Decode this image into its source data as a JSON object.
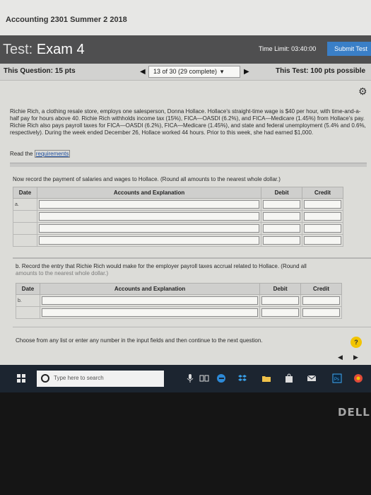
{
  "window": {
    "course_title": "Accounting 2301 Summer 2 2018"
  },
  "header": {
    "test_label": "Test:",
    "test_name": "Exam 4",
    "time_limit": "Time Limit: 03:40:00",
    "submit_label": "Submit Test"
  },
  "question_bar": {
    "question_points": "This Question: 15 pts",
    "progress": "13 of 30 (29 complete)",
    "test_points": "This Test: 100 pts possible"
  },
  "problem": {
    "text": "Richie Rich, a clothing resale store, employs one salesperson, Donna Hollace. Hollace's straight-time wage is $40 per hour, with time-and-a-half pay for hours above 40. Richie Rich withholds income tax (15%), FICA—OASDI (6.2%), and FICA—Medicare (1.45%) from Hollace's pay. Richie Rich also pays payroll taxes for FICA—OASDI (6.2%), FICA—Medicare (1.45%), and state and federal unemployment (5.4% and 0.6%, respectively). During the week ended December 26, Hollace worked 44 hours. Prior to this week, she had earned $1,000.",
    "read_prefix": "Read the",
    "requirements_link": "requirements"
  },
  "instruction": "Now record the payment of salaries and wages to Hollace. (Round all amounts to the nearest whole dollar.)",
  "table_a": {
    "headers": {
      "date": "Date",
      "accounts": "Accounts and Explanation",
      "debit": "Debit",
      "credit": "Credit"
    },
    "label": "a."
  },
  "part_b": {
    "text_main": "b. Record the entry that Richie Rich would make for the employer payroll taxes accrual related to Hollace. (Round all",
    "text_faded": "amounts to the nearest whole dollar.)"
  },
  "table_b": {
    "headers": {
      "date": "Date",
      "accounts": "Accounts and Explanation",
      "debit": "Debit",
      "credit": "Credit"
    },
    "label": "b."
  },
  "footer": {
    "message": "Choose from any list or enter any number in the input fields and then continue to the next question.",
    "help": "?"
  },
  "taskbar": {
    "search_placeholder": "Type here to search",
    "icons": [
      "windows-start-icon",
      "search-icon",
      "microphone-icon",
      "task-view-icon",
      "edge-browser-icon",
      "dropbox-icon",
      "file-explorer-icon",
      "store-icon",
      "mail-icon",
      "photoshop-icon",
      "chrome-icon"
    ]
  },
  "bezel": {
    "brand": "DELL"
  },
  "colors": {
    "header_bg": "#4f4f50",
    "submit_blue": "#3a7fc7",
    "taskbar_bg": "#1c2530"
  }
}
